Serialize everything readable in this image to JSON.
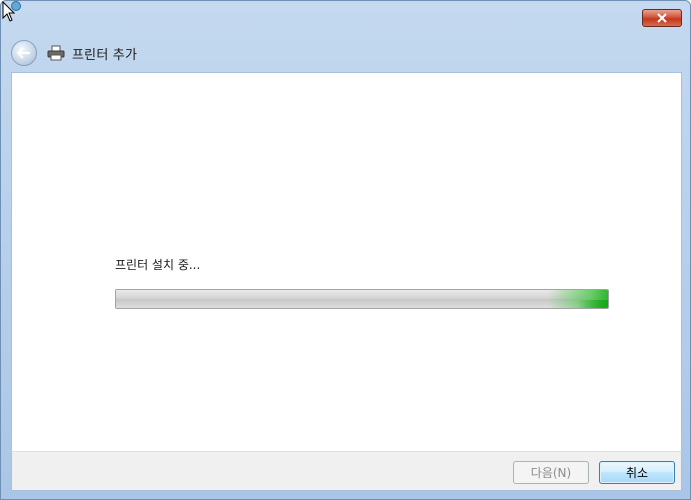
{
  "window": {
    "title": "프린터 추가"
  },
  "titlebar": {
    "close_icon": "close-icon"
  },
  "nav": {
    "back_icon": "back-arrow-icon",
    "printer_icon": "printer-icon"
  },
  "content": {
    "status_text": "프린터 설치 중...",
    "progress": 1.0,
    "progress_color": "#2fb52f"
  },
  "footer": {
    "next_label": "다음(N)",
    "cancel_label": "취소"
  },
  "colors": {
    "frame": "#b9d1ec",
    "close_button": "#c03a1e",
    "default_button_border": "#3c7fb1"
  }
}
